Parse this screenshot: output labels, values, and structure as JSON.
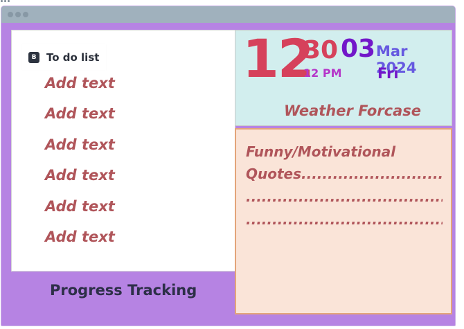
{
  "todo": {
    "badge": "B",
    "title": "To do list",
    "items": [
      "Add text",
      "Add text",
      "Add text",
      "Add text",
      "Add text",
      "Add text"
    ]
  },
  "progress": {
    "label": "Progress Tracking"
  },
  "clock": {
    "hour": "12",
    "minute": "30",
    "ampm": "12 PM",
    "day": "03",
    "month_year": "Mar 2024",
    "weekday": "Fri",
    "weather": "Weather Forcase"
  },
  "quotes": {
    "lines": [
      "Funny/Motivational",
      "Quotes.......................................",
      "..................................................",
      ".................................................."
    ]
  },
  "colors": {
    "background": "#b683e3",
    "titlebar": "#a0b1bd",
    "accent_red": "#d6415b",
    "accent_purple": "#7217c9",
    "text_rose": "#b0555a"
  }
}
